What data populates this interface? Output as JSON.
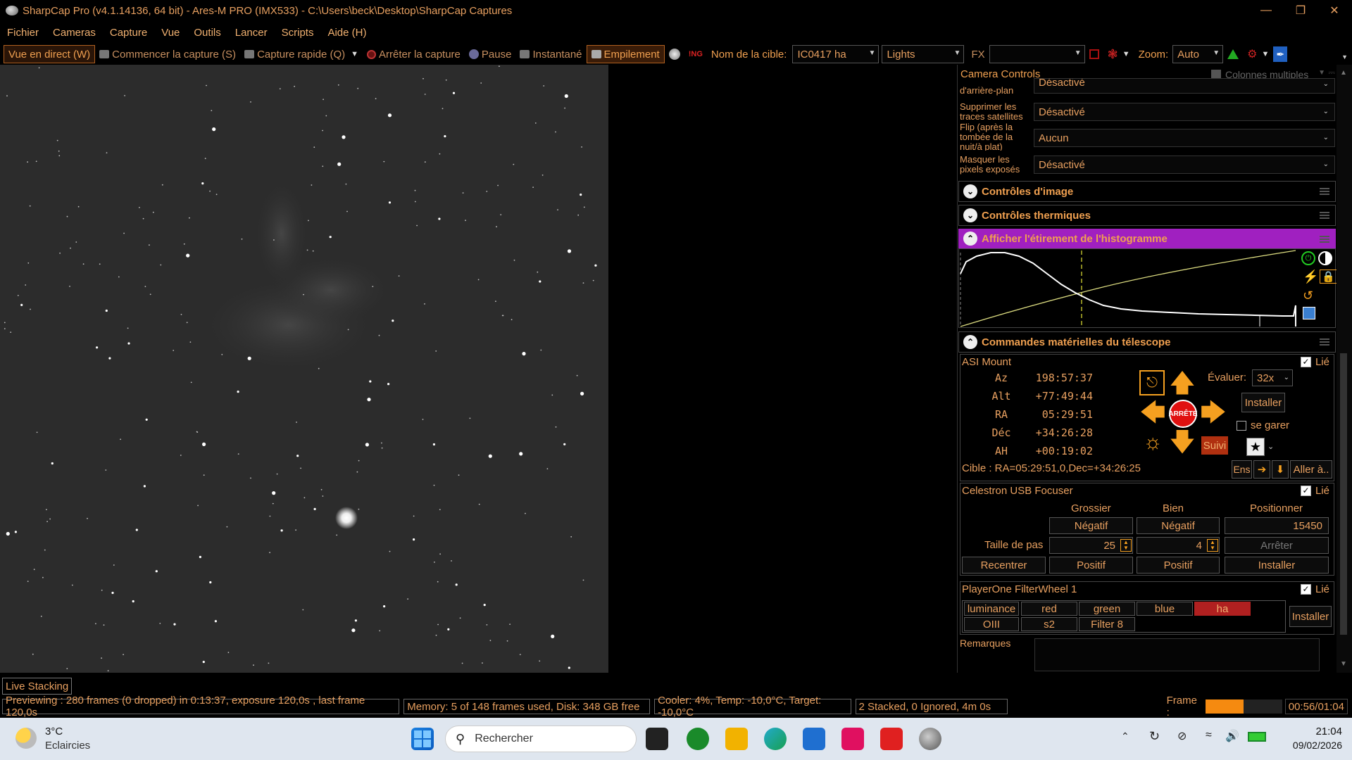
{
  "window": {
    "title": "SharpCap Pro (v4.1.14136, 64 bit) - Ares-M PRO (IMX533) - C:\\Users\\beck\\Desktop\\SharpCap Captures"
  },
  "menu": [
    "Fichier",
    "Cameras",
    "Capture",
    "Vue",
    "Outils",
    "Lancer",
    "Scripts",
    "Aide (H)"
  ],
  "toolbar": {
    "live": "Vue en direct (W)",
    "start": "Commencer la capture (S)",
    "quick": "Capture rapide (Q)",
    "stop": "Arrêter la capture",
    "pause": "Pause",
    "snapshot": "Instantané",
    "stacking": "Empilement",
    "target_label": "Nom de la cible:",
    "target_value": "IC0417 ha",
    "frame_type": "Lights",
    "fx": "FX",
    "zoom_label": "Zoom:",
    "zoom_value": "Auto"
  },
  "panel": {
    "title": "Camera Controls",
    "multi_col": "Colonnes multiples",
    "bg_label": "d'arrière-plan",
    "bg_value": "Désactivé",
    "sat_label": "Supprimer les traces satellites",
    "sat_value": "Désactivé",
    "flip_label": "Flip (après la tombée de la nuit/à plat)",
    "flip_value": "Aucun",
    "mask_label": "Masquer les pixels exposés",
    "mask_value": "Désactivé",
    "sections": {
      "image": "Contrôles d'image",
      "thermal": "Contrôles thermiques",
      "histogram": "Afficher l'étirement de l'histogramme",
      "telescope": "Commandes matérielles du télescope"
    }
  },
  "mount": {
    "name": "ASI Mount",
    "linked": "Lié",
    "coords": [
      {
        "k": "Az",
        "v": "198:57:37"
      },
      {
        "k": "Alt",
        "v": "+77:49:44"
      },
      {
        "k": "RA",
        "v": "05:29:51"
      },
      {
        "k": "Déc",
        "v": "+34:26:28"
      },
      {
        "k": "AH",
        "v": "+00:19:02"
      }
    ],
    "rate_label": "Évaluer:",
    "rate_value": "32x",
    "stop": "ARRÊTE",
    "install": "Installer",
    "park": "se garer",
    "track": "Suivi",
    "target": "Cible : RA=05:29:51,0,Dec=+34:26:25",
    "ens": "Ens",
    "goto": "Aller à.."
  },
  "focuser": {
    "name": "Celestron USB Focuser",
    "linked": "Lié",
    "cols": [
      "Grossier",
      "Bien",
      "Positionner"
    ],
    "neg": "Négatif",
    "pos": "Positif",
    "position": "15450",
    "step_label": "Taille de pas",
    "coarse_step": "25",
    "fine_step": "4",
    "stop": "Arrêter",
    "recenter": "Recentrer",
    "install": "Installer"
  },
  "filterwheel": {
    "name": "PlayerOne FilterWheel 1",
    "linked": "Lié",
    "filters": [
      "luminance",
      "red",
      "green",
      "blue",
      "ha",
      "OIII",
      "s2",
      "Filter 8"
    ],
    "selected": "ha",
    "install": "Installer"
  },
  "notes": {
    "label": "Remarques"
  },
  "live_stacking": "Live Stacking",
  "status": {
    "preview": "Previewing : 280 frames (0 dropped) in 0:13:37, exposure 120,0s , last frame 120,0s",
    "memory": "Memory: 5 of 148 frames used, Disk: 348 GB free",
    "cooler": "Cooler: 4%, Temp: -10,0°C, Target: -10,0°C",
    "stacked": "2 Stacked, 0 Ignored, 4m 0s",
    "frame_label": "Frame :",
    "frame_progress": 0.5,
    "time": "00:56/01:04"
  },
  "taskbar": {
    "weather_temp": "3°C",
    "weather_desc": "Eclaircies",
    "search": "Rechercher",
    "clock_time": "21:04",
    "clock_date": "09/02/2026"
  },
  "colors": {
    "accent": "#e8a060",
    "histogram_header": "#a020c0",
    "selected_filter": "#b02020",
    "arrow": "#f5a020"
  }
}
